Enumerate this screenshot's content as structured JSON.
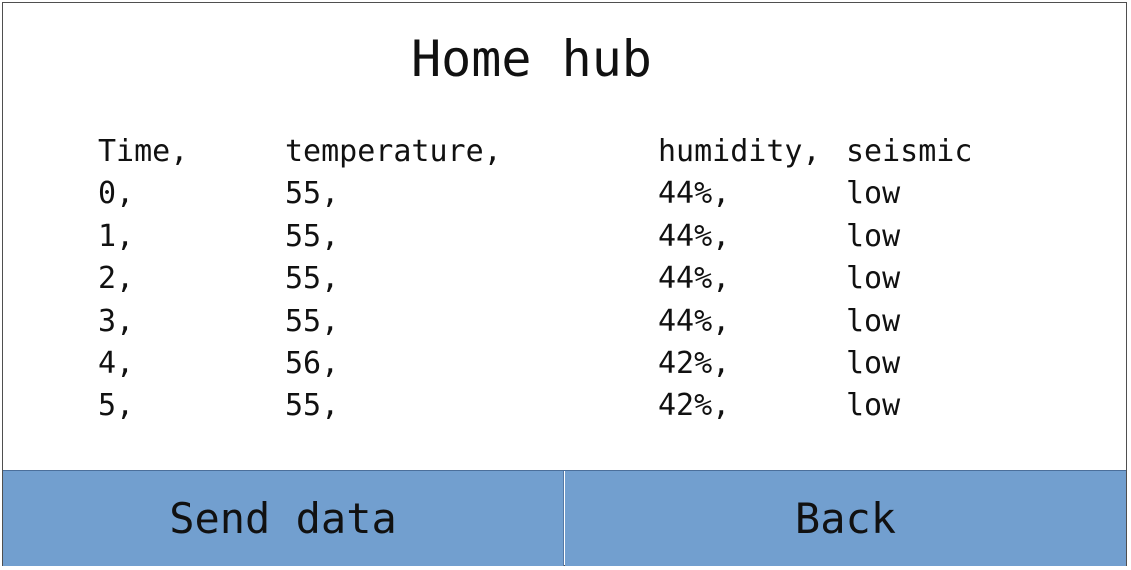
{
  "title": "Home hub",
  "table": {
    "headers": [
      "Time,",
      "temperature,",
      "humidity,",
      "seismic"
    ],
    "rows": [
      [
        "0,",
        "55,",
        "44%,",
        "low"
      ],
      [
        "1,",
        "55,",
        "44%,",
        "low"
      ],
      [
        "2,",
        "55,",
        "44%,",
        "low"
      ],
      [
        "3,",
        "55,",
        "44%,",
        "low"
      ],
      [
        "4,",
        "56,",
        "42%,",
        "low"
      ],
      [
        "5,",
        "55,",
        "42%,",
        "low"
      ]
    ]
  },
  "buttons": {
    "send_data": "Send data",
    "back": "Back"
  },
  "colors": {
    "button_fill": "#729fcf",
    "frame_border": "#4f4f4f"
  }
}
